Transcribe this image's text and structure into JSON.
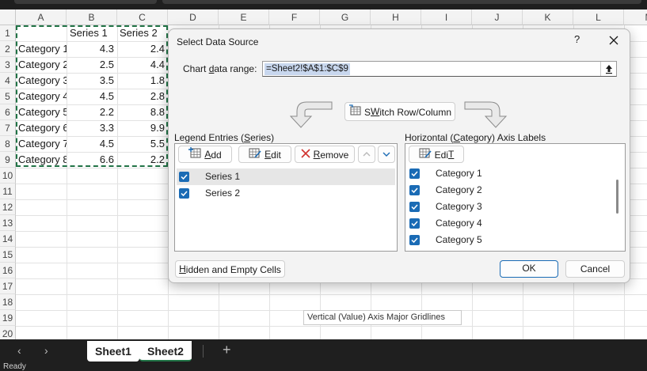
{
  "spreadsheet": {
    "columns": [
      "A",
      "B",
      "C",
      "D",
      "E",
      "F",
      "G",
      "H",
      "I",
      "J",
      "K",
      "L",
      "M"
    ],
    "rows": [
      "1",
      "2",
      "3",
      "4",
      "5",
      "6",
      "7",
      "8",
      "9",
      "10",
      "11",
      "12",
      "13",
      "14",
      "15",
      "16",
      "17",
      "18",
      "19",
      "20"
    ],
    "header_row": {
      "b": "Series 1",
      "c": "Series 2"
    },
    "data": [
      {
        "a": "Category 1",
        "b": "4.3",
        "c": "2.4"
      },
      {
        "a": "Category 2",
        "b": "2.5",
        "c": "4.4"
      },
      {
        "a": "Category 3",
        "b": "3.5",
        "c": "1.8"
      },
      {
        "a": "Category 4",
        "b": "4.5",
        "c": "2.8"
      },
      {
        "a": "Category 5",
        "b": "2.2",
        "c": "8.8"
      },
      {
        "a": "Category 6",
        "b": "3.3",
        "c": "9.9"
      },
      {
        "a": "Category 7",
        "b": "4.5",
        "c": "5.5"
      },
      {
        "a": "Category 8",
        "b": "6.6",
        "c": "2.2"
      }
    ]
  },
  "dialog": {
    "title": "Select Data Source",
    "help": "?",
    "chart_range_label_pre": "Chart ",
    "chart_range_label_u": "d",
    "chart_range_label_post": "ata range:",
    "chart_range_value": "=Sheet2!$A$1:$C$9",
    "switch_button": {
      "u": "W",
      "pre": "S",
      "post": "itch Row/Column"
    },
    "legend_label": {
      "pre": "Legend Entries (",
      "u": "S",
      "post": "eries)"
    },
    "legend_buttons": {
      "add": {
        "u": "A",
        "post": "dd"
      },
      "edit": {
        "u": "E",
        "post": "dit"
      },
      "remove": {
        "u": "R",
        "post": "emove"
      }
    },
    "series": [
      {
        "label": "Series 1",
        "checked": true,
        "selected": true
      },
      {
        "label": "Series 2",
        "checked": true,
        "selected": false
      }
    ],
    "axis_label": {
      "pre": "Horizontal (",
      "u": "C",
      "post": "ategory) Axis Labels"
    },
    "axis_edit": {
      "u": "T",
      "pre": "Edi",
      "post": ""
    },
    "categories": [
      {
        "label": "Category 1",
        "checked": true
      },
      {
        "label": "Category 2",
        "checked": true
      },
      {
        "label": "Category 3",
        "checked": true
      },
      {
        "label": "Category 4",
        "checked": true
      },
      {
        "label": "Category 5",
        "checked": true
      }
    ],
    "hidden_cells": {
      "u": "H",
      "post": "idden and Empty Cells"
    },
    "ok": "OK",
    "cancel": "Cancel"
  },
  "tooltip": "Vertical (Value) Axis Major Gridlines",
  "sheets": [
    {
      "label": "Sheet1",
      "active": false
    },
    {
      "label": "Sheet2",
      "active": true
    }
  ],
  "status": "Ready",
  "colors": {
    "accent": "#217346",
    "checkbox": "#1a6bb5",
    "selection": "#c8d7ee"
  }
}
